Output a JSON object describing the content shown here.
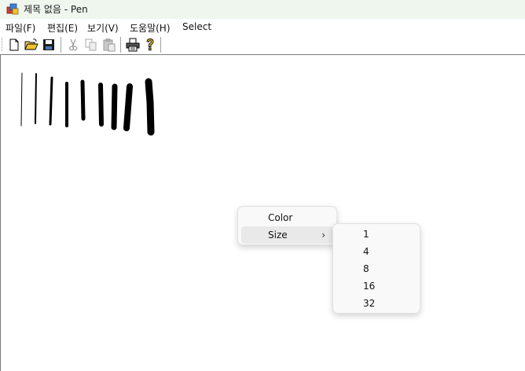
{
  "window": {
    "title": "제목 없음 - Pen"
  },
  "menubar": {
    "items": [
      "파일(F)",
      "편집(E)",
      "보기(V)",
      "도움말(H)",
      "Select"
    ]
  },
  "toolbar": {
    "buttons": [
      {
        "icon": "new-document-icon",
        "enabled": true
      },
      {
        "icon": "open-folder-icon",
        "enabled": true
      },
      {
        "icon": "save-disk-icon",
        "enabled": true
      },
      {
        "icon": "cut-scissors-icon",
        "enabled": false
      },
      {
        "icon": "copy-icon",
        "enabled": false
      },
      {
        "icon": "paste-icon",
        "enabled": false
      },
      {
        "icon": "print-icon",
        "enabled": true
      },
      {
        "icon": "help-question-icon",
        "enabled": true
      }
    ]
  },
  "context_menu": {
    "items": [
      {
        "label": "Color",
        "has_submenu": false
      },
      {
        "label": "Size",
        "has_submenu": true,
        "highlighted": true
      }
    ]
  },
  "size_submenu": {
    "items": [
      "1",
      "4",
      "8",
      "16",
      "32"
    ]
  },
  "colors": {
    "titlebar": "#eef6ee",
    "stroke": "#000000",
    "menu_bg": "#f9f9f9",
    "menu_hover": "#e9e9e9"
  }
}
